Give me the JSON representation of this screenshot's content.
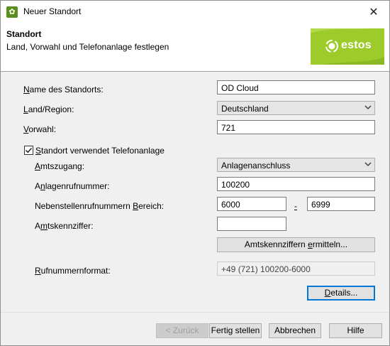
{
  "window": {
    "title": "Neuer Standort",
    "close_glyph": "✕"
  },
  "header": {
    "title": "Standort",
    "subtitle": "Land, Vorwahl und Telefonanlage festlegen",
    "logo_text": "estos"
  },
  "form": {
    "name_label_u": "N",
    "name_label_rest": "ame des Standorts:",
    "name_value": "OD Cloud",
    "country_label_pre": "",
    "country_label_u": "L",
    "country_label_rest": "and/Region:",
    "country_value": "Deutschland",
    "prefix_label_u": "V",
    "prefix_label_rest": "orwahl:",
    "prefix_value": "721",
    "pbx_checkbox_label_u": "S",
    "pbx_checkbox_label_rest": "tandort verwendet Telefonanlage",
    "pbx_checked": true,
    "trunk_label_u": "A",
    "trunk_label_rest": "mtszugang:",
    "trunk_value": "Anlagenanschluss",
    "pbx_number_label_pre": "A",
    "pbx_number_label_u": "n",
    "pbx_number_label_rest": "lagenrufnummer:",
    "pbx_number_value": "100200",
    "ext_range_label_pre": "Nebenstellenrufnummern ",
    "ext_range_label_u": "B",
    "ext_range_label_rest": "ereich:",
    "ext_range_from": "6000",
    "ext_range_sep": "-",
    "ext_range_to": "6999",
    "access_code_label_pre": "A",
    "access_code_label_u": "m",
    "access_code_label_rest": "tskennziffer:",
    "access_code_value": "",
    "detect_button_pre": "Amtskennziffern ",
    "detect_button_u": "e",
    "detect_button_rest": "rmitteln...",
    "format_label_u": "R",
    "format_label_rest": "ufnummernformat:",
    "format_value": "+49 (721) 100200-6000",
    "details_button_u": "D",
    "details_button_rest": "etails..."
  },
  "footer": {
    "back_label": "< Zurück",
    "finish_label": "Fertig stellen",
    "cancel_label": "Abbrechen",
    "help_label": "Hilfe"
  },
  "colors": {
    "accent": "#0078d7",
    "logo_green": "#9ccb2a"
  },
  "icons": {
    "app": "gear-icon",
    "close": "close-icon",
    "dropdown": "chevron-down-icon",
    "check": "checkmark-icon"
  }
}
